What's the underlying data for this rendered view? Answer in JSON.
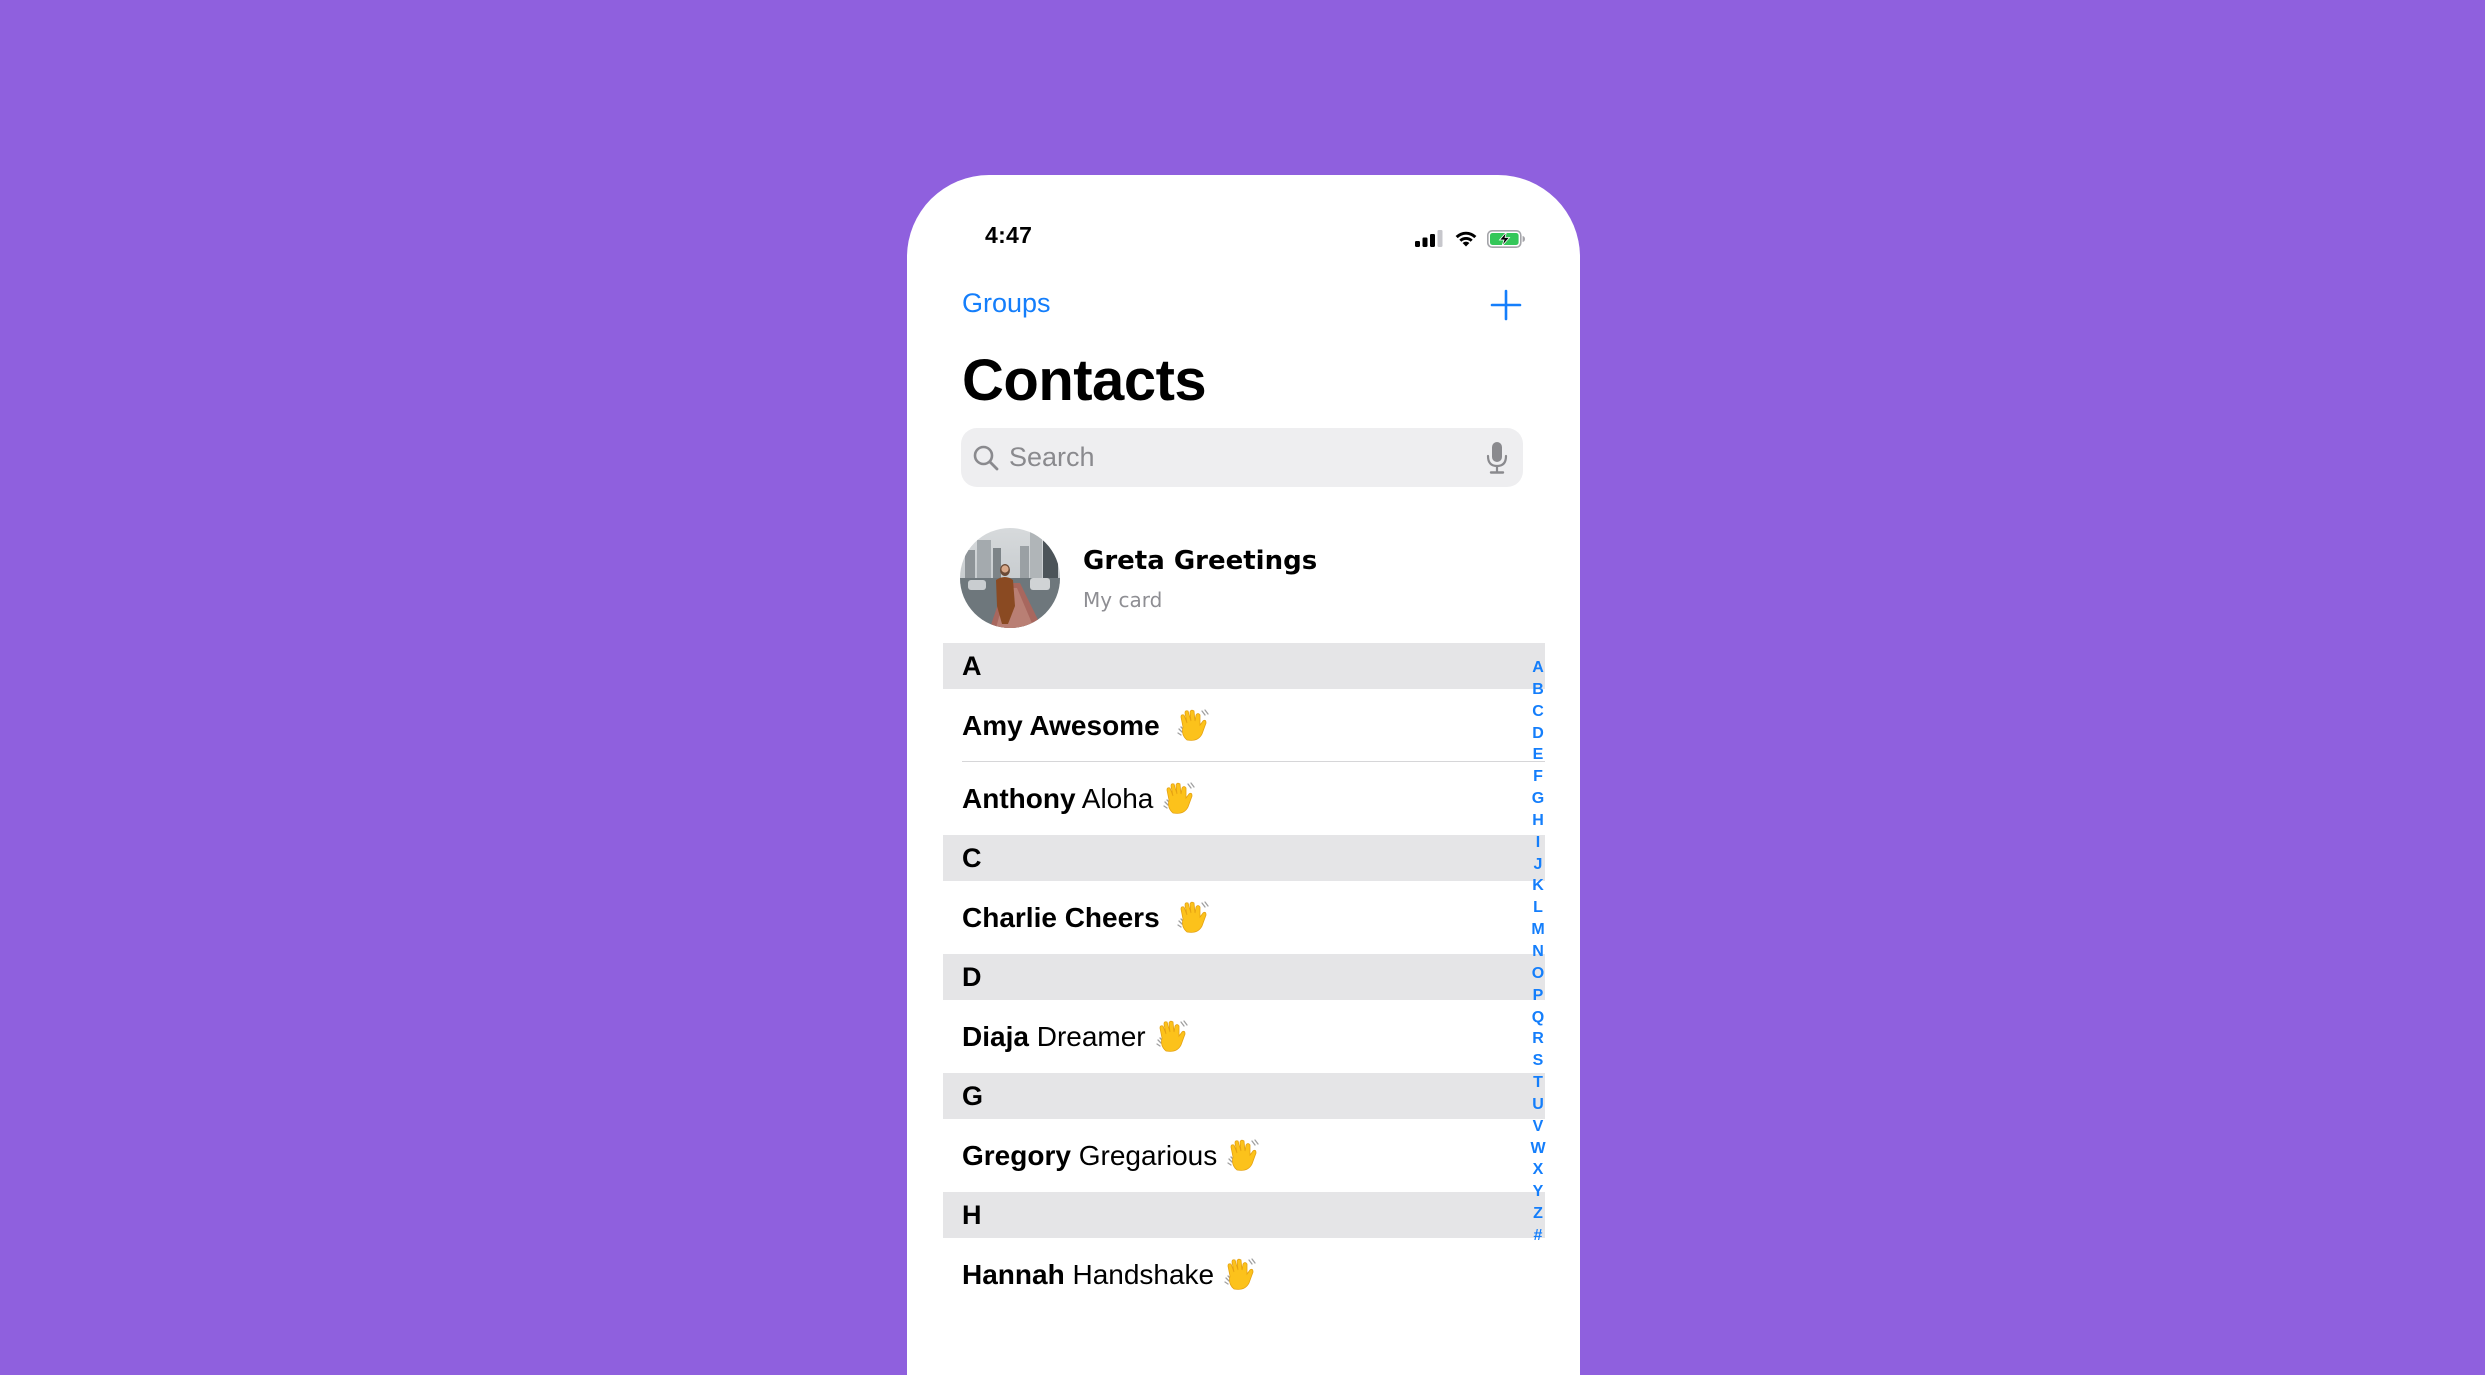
{
  "status_bar": {
    "time": "4:47",
    "signal_bars": 3,
    "signal_bars_total": 4,
    "wifi": "connected",
    "battery": "charging",
    "battery_color": "#34c759"
  },
  "nav": {
    "groups_label": "Groups",
    "add_icon": "plus-icon",
    "title": "Contacts"
  },
  "search": {
    "placeholder": "Search",
    "value": "",
    "icon": "search-icon",
    "mic_icon": "mic-icon"
  },
  "my_card": {
    "name": "Greta Greetings",
    "subtitle": "My card",
    "avatar": "photo-avatar"
  },
  "sections": [
    {
      "letter": "A",
      "contacts": [
        {
          "first": "Amy Awesome",
          "last": "",
          "emoji": "👋"
        },
        {
          "first": "Anthony",
          "last": "Aloha",
          "emoji": "👋"
        }
      ]
    },
    {
      "letter": "C",
      "contacts": [
        {
          "first": "Charlie Cheers",
          "last": "",
          "emoji": "👋"
        }
      ]
    },
    {
      "letter": "D",
      "contacts": [
        {
          "first": "Diaja",
          "last": "Dreamer",
          "emoji": "👋"
        }
      ]
    },
    {
      "letter": "G",
      "contacts": [
        {
          "first": "Gregory",
          "last": "Gregarious",
          "emoji": "👋"
        }
      ]
    },
    {
      "letter": "H",
      "contacts": [
        {
          "first": "Hannah",
          "last": "Handshake",
          "emoji": "👋"
        }
      ]
    }
  ],
  "index_letters": [
    "A",
    "B",
    "C",
    "D",
    "E",
    "F",
    "G",
    "H",
    "I",
    "J",
    "K",
    "L",
    "M",
    "N",
    "O",
    "P",
    "Q",
    "R",
    "S",
    "T",
    "U",
    "V",
    "W",
    "X",
    "Y",
    "Z",
    "#"
  ],
  "colors": {
    "background": "#8f60de",
    "accent": "#147efb",
    "section_header": "#e5e5e7",
    "secondary_text": "#8e8e93"
  }
}
